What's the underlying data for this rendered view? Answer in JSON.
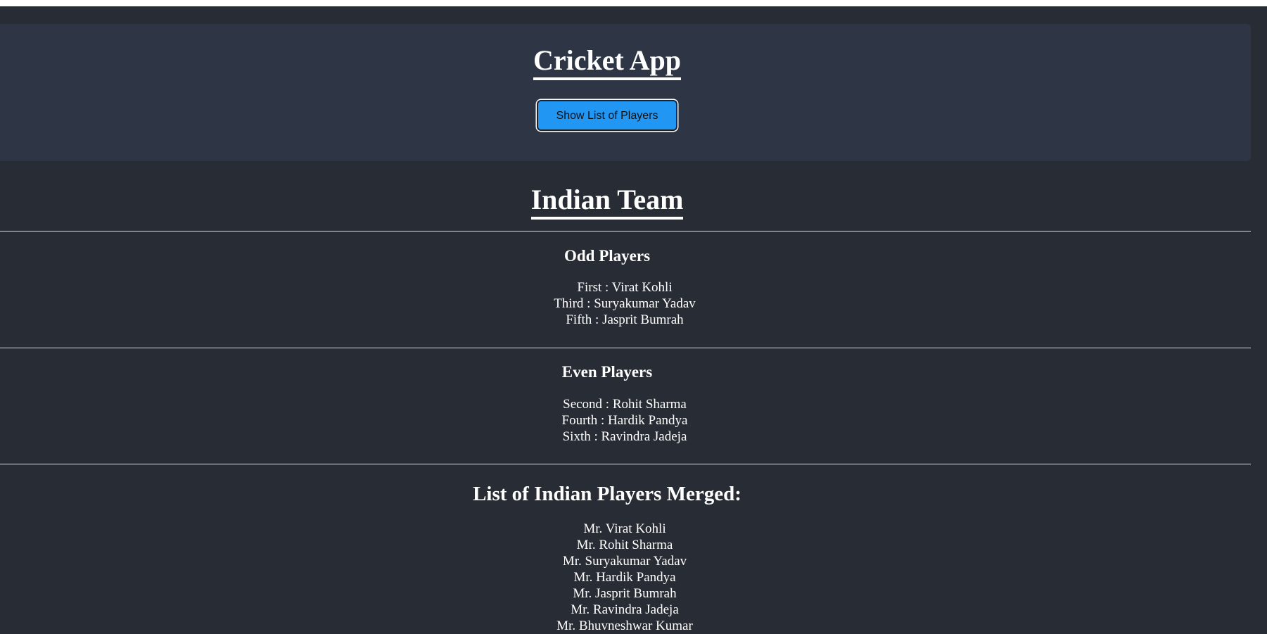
{
  "header": {
    "title": "Cricket App",
    "button_label": "Show List of Players"
  },
  "team": {
    "title": "Indian Team"
  },
  "odd": {
    "heading": "Odd Players",
    "players": [
      "First : Virat Kohli",
      "Third : Suryakumar Yadav",
      "Fifth : Jasprit Bumrah"
    ]
  },
  "even": {
    "heading": "Even Players",
    "players": [
      "Second : Rohit Sharma",
      "Fourth : Hardik Pandya",
      "Sixth : Ravindra Jadeja"
    ]
  },
  "merged": {
    "heading": "List of Indian Players Merged:",
    "players": [
      "Mr. Virat Kohli",
      "Mr. Rohit Sharma",
      "Mr. Suryakumar Yadav",
      "Mr. Hardik Pandya",
      "Mr. Jasprit Bumrah",
      "Mr. Ravindra Jadeja",
      "Mr. Bhuvneshwar Kumar"
    ]
  },
  "colors": {
    "page_background": "#282c34",
    "header_background": "#2e3646",
    "button_background": "#2196f3",
    "text": "#ffffff"
  }
}
